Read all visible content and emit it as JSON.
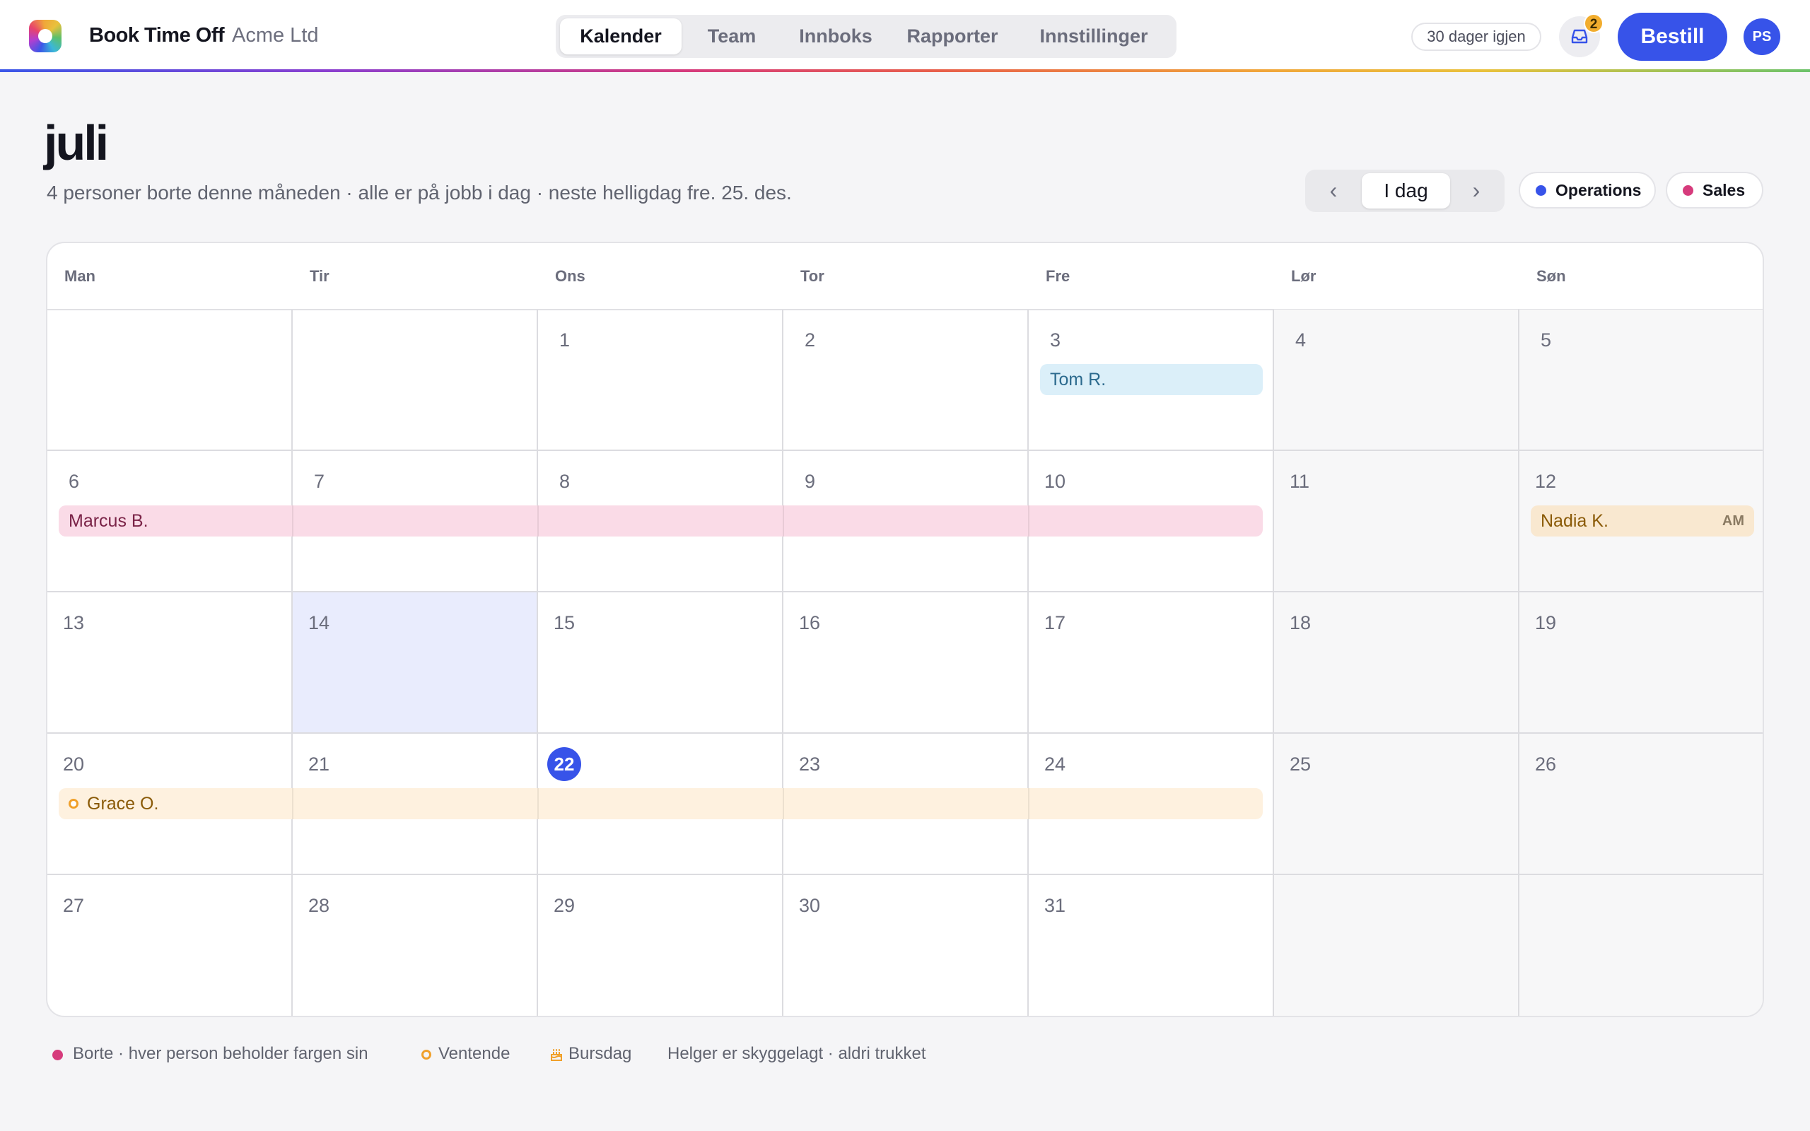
{
  "header": {
    "app_name": "Book Time Off",
    "org_name": "Acme Ltd",
    "tabs": [
      {
        "label": "Kalender",
        "active": true
      },
      {
        "label": "Team",
        "active": false
      },
      {
        "label": "Innboks",
        "active": false
      },
      {
        "label": "Rapporter",
        "active": false
      },
      {
        "label": "Innstillinger",
        "active": false
      }
    ],
    "days_left": "30 dager igjen",
    "inbox_icon": "inbox-icon",
    "inbox_badge": "2",
    "book_button": "Bestill",
    "avatar_initials": "PS"
  },
  "colors": {
    "accent": "#3753e9",
    "operations": "#3753e9",
    "sales": "#d63b7c",
    "pending": "#f0a02a"
  },
  "page": {
    "month": "juli",
    "subtitle": "4 personer borte denne måneden · alle er på jobb i dag · neste helligdag fre. 25. des.",
    "prev_icon": "‹",
    "today_button": "I dag",
    "next_icon": "›",
    "filters": [
      {
        "label": "Operations",
        "color": "#3753e9"
      },
      {
        "label": "Sales",
        "color": "#d63b7c"
      }
    ]
  },
  "calendar": {
    "weekdays": [
      "Man",
      "Tir",
      "Ons",
      "Tor",
      "Fre",
      "Lør",
      "Søn"
    ],
    "today": "22",
    "selected": "14",
    "weeks": [
      [
        "",
        "",
        "1",
        "2",
        "3",
        "4",
        "5"
      ],
      [
        "6",
        "7",
        "8",
        "9",
        "10",
        "11",
        "12"
      ],
      [
        "13",
        "14",
        "15",
        "16",
        "17",
        "18",
        "19"
      ],
      [
        "20",
        "21",
        "22",
        "23",
        "24",
        "25",
        "26"
      ],
      [
        "27",
        "28",
        "29",
        "30",
        "31",
        "",
        ""
      ]
    ],
    "events": [
      {
        "name": "Tom R.",
        "status": "away",
        "start": "3",
        "end": "3",
        "tag": ""
      },
      {
        "name": "Marcus B.",
        "status": "away",
        "start": "6",
        "end": "10",
        "tag": ""
      },
      {
        "name": "Nadia K.",
        "status": "away",
        "start": "12",
        "end": "12",
        "tag": "AM"
      },
      {
        "name": "Grace O.",
        "status": "pending",
        "start": "20",
        "end": "24",
        "tag": ""
      }
    ]
  },
  "legend": {
    "away": "Borte · hver person beholder fargen sin",
    "pending": "Ventende",
    "birthday": "Bursdag",
    "weekends": "Helger er skyggelagt · aldri trukket"
  }
}
